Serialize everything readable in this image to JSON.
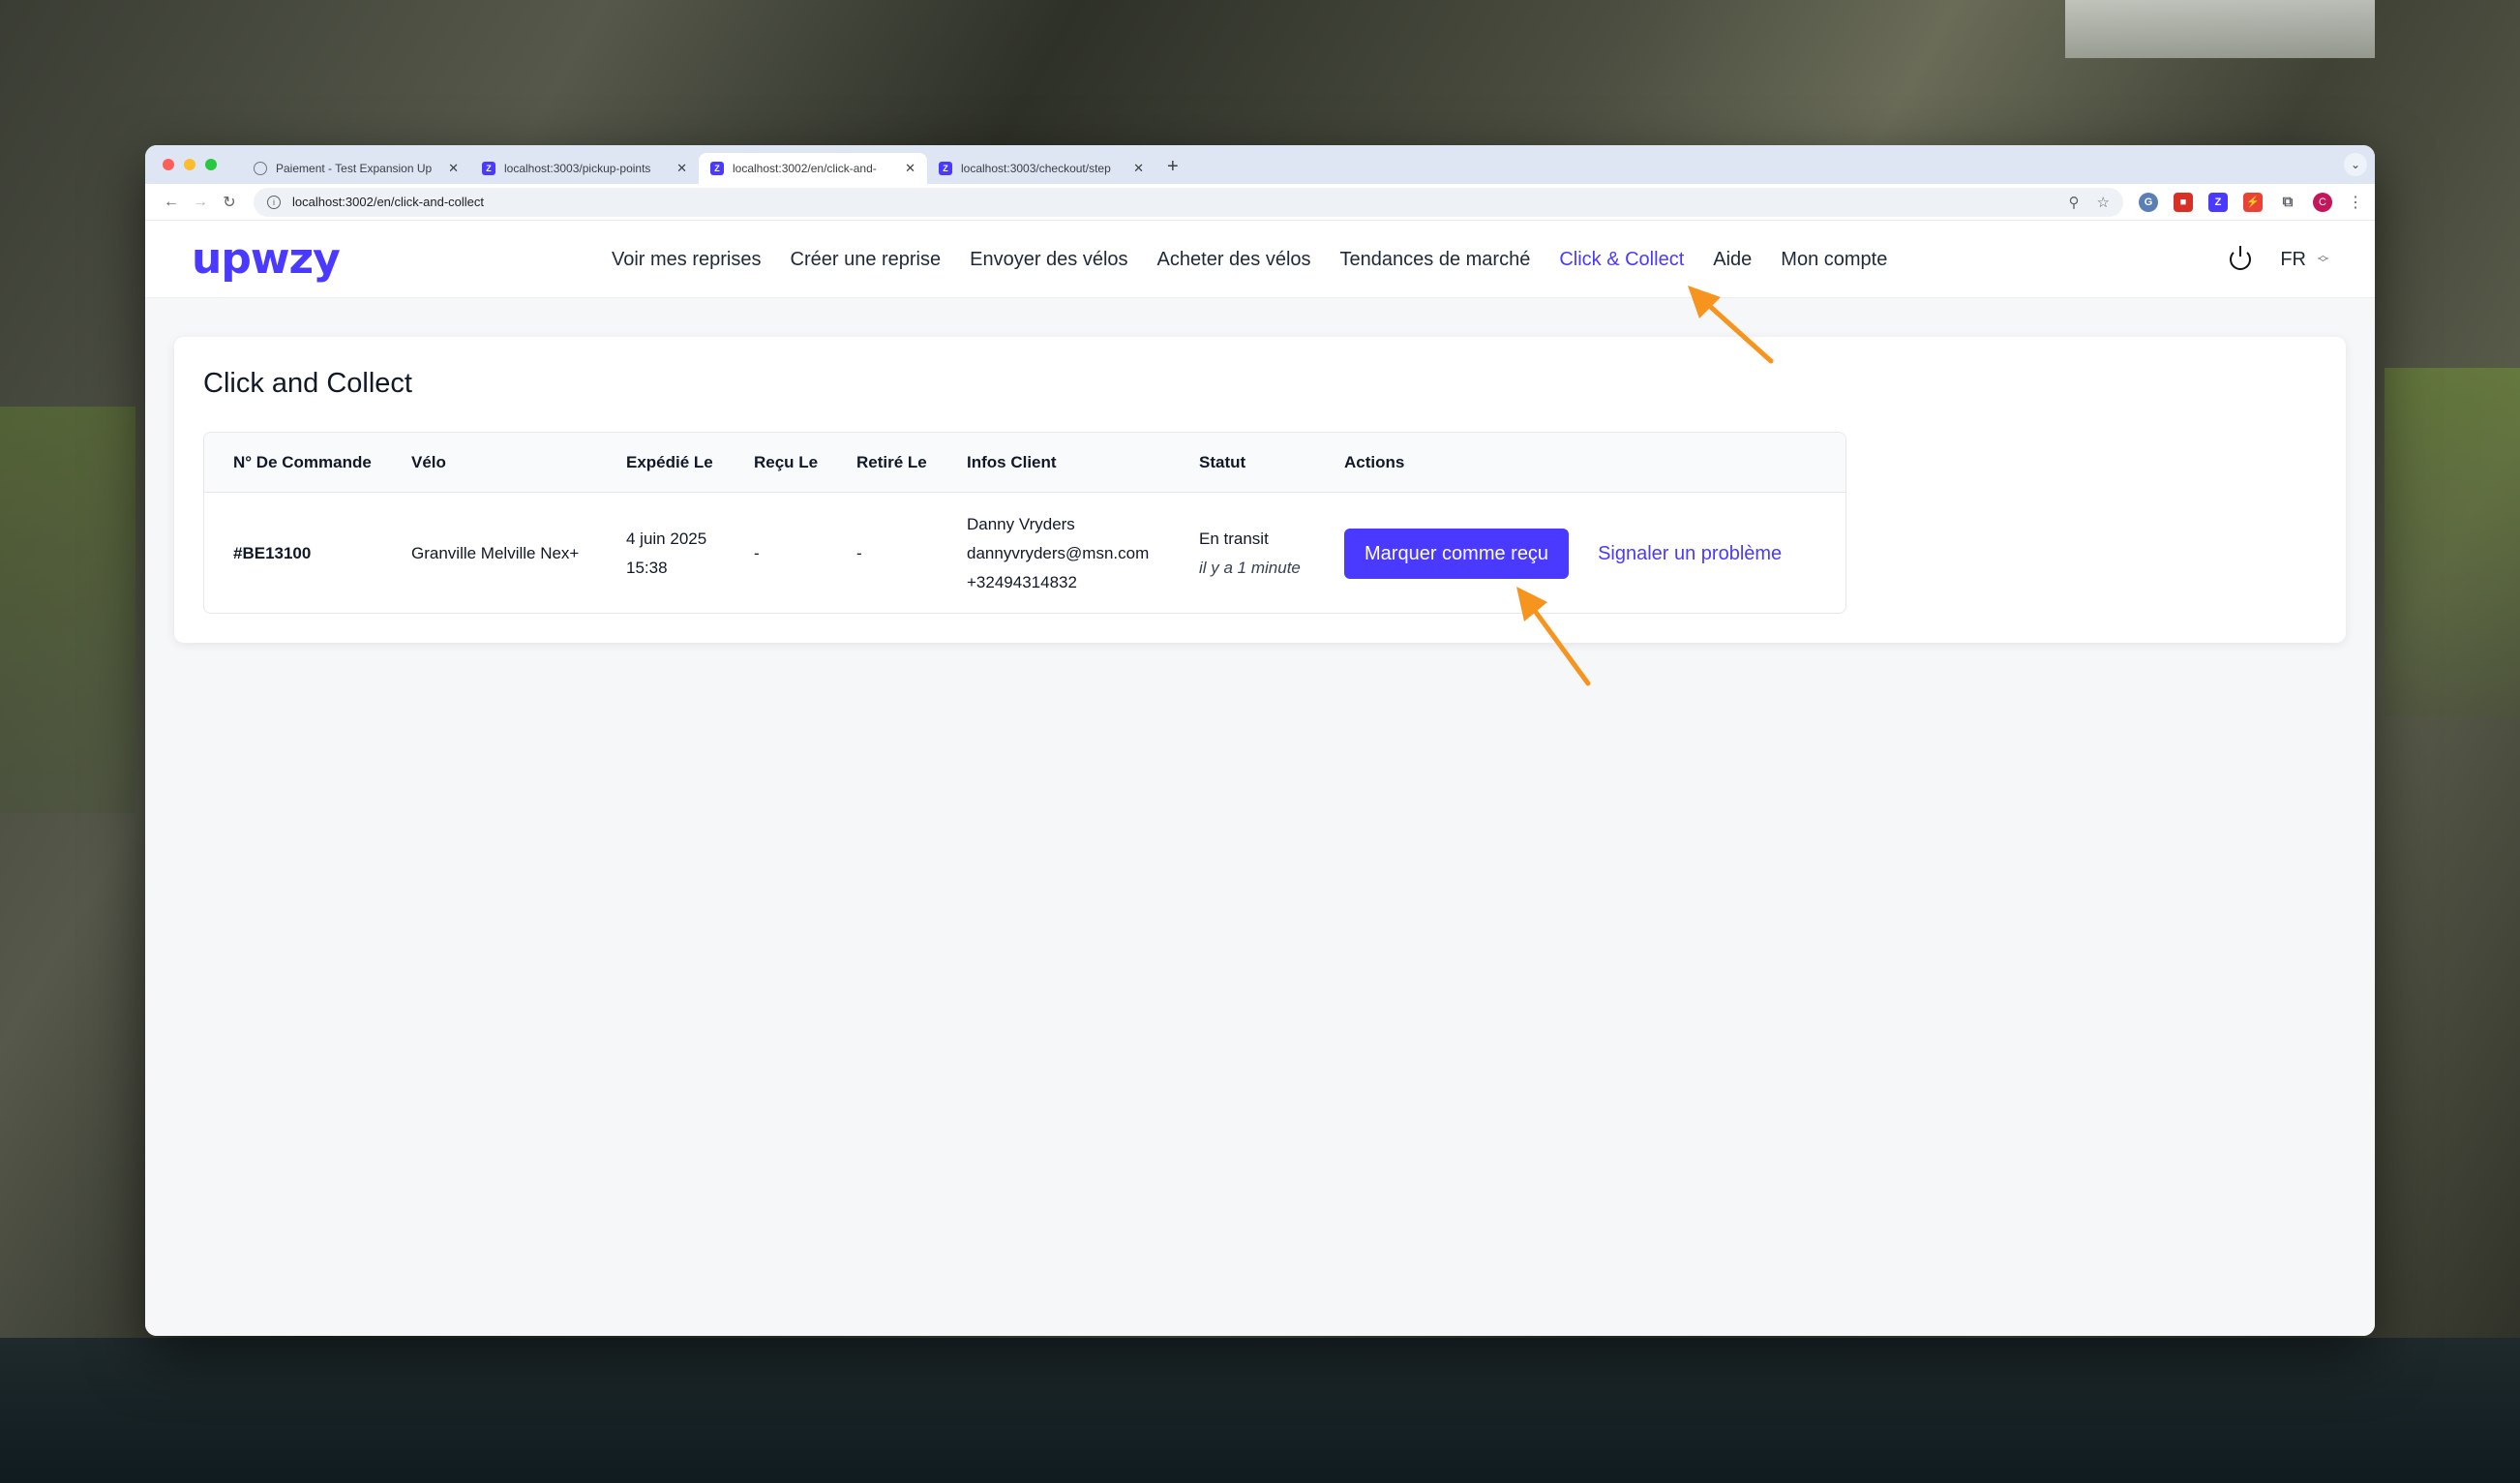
{
  "browser": {
    "tabs": [
      {
        "title": "Paiement - Test Expansion Up",
        "icon": "globe-icon"
      },
      {
        "title": "localhost:3003/pickup-points",
        "icon": "upwzy-favicon"
      },
      {
        "title": "localhost:3002/en/click-and-",
        "icon": "upwzy-favicon"
      },
      {
        "title": "localhost:3003/checkout/step",
        "icon": "upwzy-favicon"
      }
    ],
    "url": "localhost:3002/en/click-and-collect",
    "new_tab": "+",
    "avatar_letter": "C"
  },
  "site": {
    "logo": "upwzy",
    "nav": [
      "Voir mes reprises",
      "Créer une reprise",
      "Envoyer des vélos",
      "Acheter des vélos",
      "Tendances de marché",
      "Click & Collect",
      "Aide",
      "Mon compte"
    ],
    "active_nav": "Click & Collect",
    "language": "FR",
    "accent_color": "#4a3aff"
  },
  "page": {
    "title": "Click and Collect",
    "table": {
      "headers": [
        "N° De Commande",
        "Vélo",
        "Expédié Le",
        "Reçu Le",
        "Retiré Le",
        "Infos Client",
        "Statut",
        "Actions"
      ],
      "rows": [
        {
          "order": "#BE13100",
          "bike": "Granville Melville Nex+",
          "shipped_date": "4 juin 2025",
          "shipped_time": "15:38",
          "received": "-",
          "collected": "-",
          "client_name": "Danny Vryders",
          "client_email": "dannyvryders@msn.com",
          "client_phone": "+32494314832",
          "status": "En transit",
          "status_time": "il y a 1 minute",
          "action_primary": "Marquer comme reçu",
          "action_secondary": "Signaler un problème"
        }
      ]
    }
  },
  "annotations": {
    "arrow_color": "#f7941d"
  }
}
